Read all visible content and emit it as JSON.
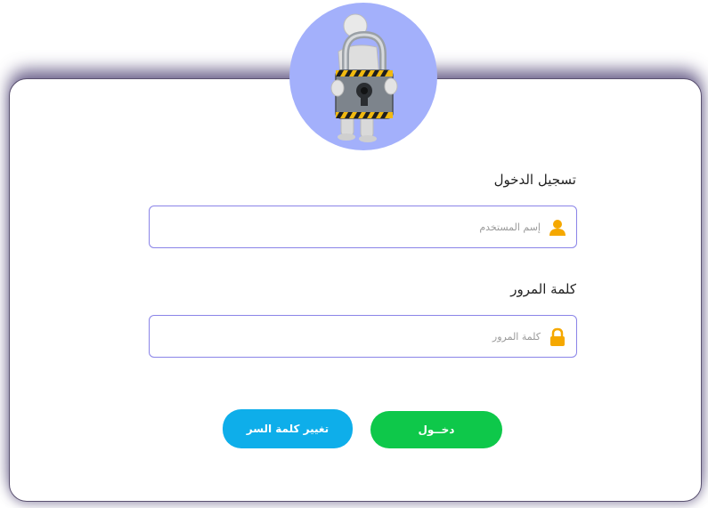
{
  "login_form": {
    "title": "تسجيل الدخول",
    "username_label": "تسجيل الدخول",
    "username_placeholder": "إسم المستخدم",
    "username_value": "",
    "password_label": "كلمة المرور",
    "password_placeholder": "كلمة المرور",
    "password_value": ""
  },
  "buttons": {
    "login": "دخــول",
    "change_password": "تغيير كلمة السر"
  },
  "colors": {
    "accent_icon": "#f5a800",
    "login_button": "#0ec84a",
    "change_button": "#0eaeea",
    "avatar_bg": "#a3b0fb",
    "input_border": "#8a84e8"
  },
  "icons": {
    "user": "user-icon",
    "lock": "lock-icon",
    "avatar": "padlock-figure-icon"
  }
}
